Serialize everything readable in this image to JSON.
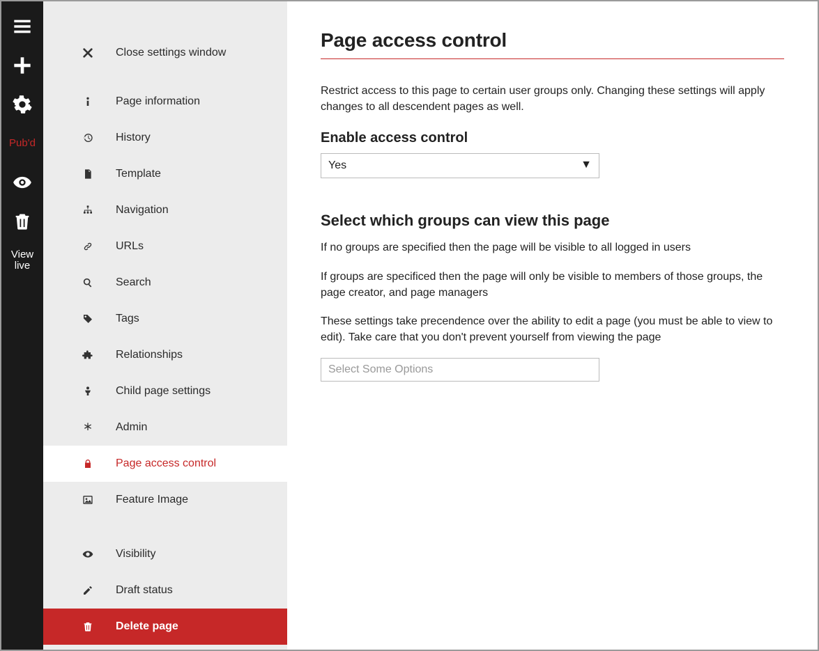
{
  "rail": {
    "pubd_label": "Pub'd",
    "view_live_label": "View\nlive"
  },
  "settings_nav": {
    "close_label": "Close settings window",
    "items": [
      {
        "label": "Page information"
      },
      {
        "label": "History"
      },
      {
        "label": "Template"
      },
      {
        "label": "Navigation"
      },
      {
        "label": "URLs"
      },
      {
        "label": "Search"
      },
      {
        "label": "Tags"
      },
      {
        "label": "Relationships"
      },
      {
        "label": "Child page settings"
      },
      {
        "label": "Admin"
      },
      {
        "label": "Page access control"
      },
      {
        "label": "Feature Image"
      }
    ],
    "items2": [
      {
        "label": "Visibility"
      },
      {
        "label": "Draft status"
      }
    ],
    "delete_label": "Delete page"
  },
  "main": {
    "title": "Page access control",
    "intro": "Restrict access to this page to certain user groups only. Changing these settings will apply changes to all descendent pages as well.",
    "enable_label": "Enable access control",
    "enable_value": "Yes",
    "groups_title": "Select which groups can view this page",
    "groups_p1": "If no groups are specified then the page will be visible to all logged in users",
    "groups_p2": "If groups are specificed then the page will only be visible to members of those groups, the page creator, and page managers",
    "groups_p3": "These settings take precendence over the ability to edit a page (you must be able to view to edit). Take care that you don't prevent yourself from viewing the page",
    "groups_placeholder": "Select Some Options"
  }
}
